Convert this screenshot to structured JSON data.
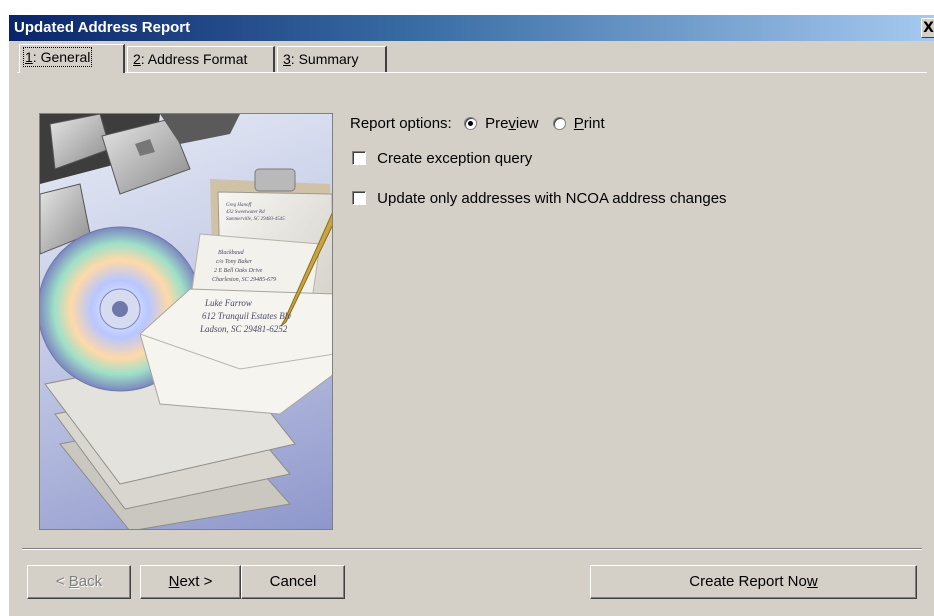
{
  "window": {
    "title": "Updated Address Report",
    "close_glyph": "X"
  },
  "tabs": [
    {
      "label": "1: General",
      "mnemonic": "1",
      "rest": ": General",
      "active": true
    },
    {
      "label": "2: Address Format",
      "mnemonic": "2",
      "rest": ": Address Format",
      "active": false
    },
    {
      "label": "3: Summary",
      "mnemonic": "3",
      "rest": ": Summary",
      "active": false
    }
  ],
  "general": {
    "report_options_label": "Report options:",
    "preview": {
      "pre": "Pre",
      "mnemonic": "v",
      "post": "iew",
      "checked": true
    },
    "print": {
      "pre": "",
      "mnemonic": "P",
      "post": "rint",
      "checked": false
    },
    "create_exception_query": {
      "label": "Create exception query",
      "checked": false
    },
    "update_ncoa_only": {
      "label": "Update only addresses with NCOA address changes",
      "checked": false
    }
  },
  "illustration": {
    "envelope_lines": [
      "Luke Farrow",
      "612 Tranquil Estates Blv",
      "Ladson, SC 29481-6252"
    ],
    "card_lines": [
      "Blackbaud",
      "c/o Tony Baker",
      "2 E Bell Oaks Drive",
      "Charleston, SC 29485-679"
    ],
    "clip_lines": [
      "Greg Hanoff",
      "432 Sweetwater Rd",
      "Summerville, SC 29483-4545"
    ]
  },
  "buttons": {
    "back": {
      "pre": "< ",
      "mnemonic": "B",
      "post": "ack",
      "enabled": false
    },
    "next": {
      "pre": "",
      "mnemonic": "N",
      "post": "ext >",
      "enabled": true
    },
    "cancel": {
      "label": "Cancel",
      "enabled": true
    },
    "create": {
      "pre": "Create Report No",
      "mnemonic": "w",
      "post": "",
      "enabled": true
    }
  },
  "colors": {
    "dialog_face": "#d4d0c8",
    "title_gradient_start": "#0a246a",
    "title_gradient_end": "#a6caf0",
    "illustration_sky": "#8e97cb"
  }
}
